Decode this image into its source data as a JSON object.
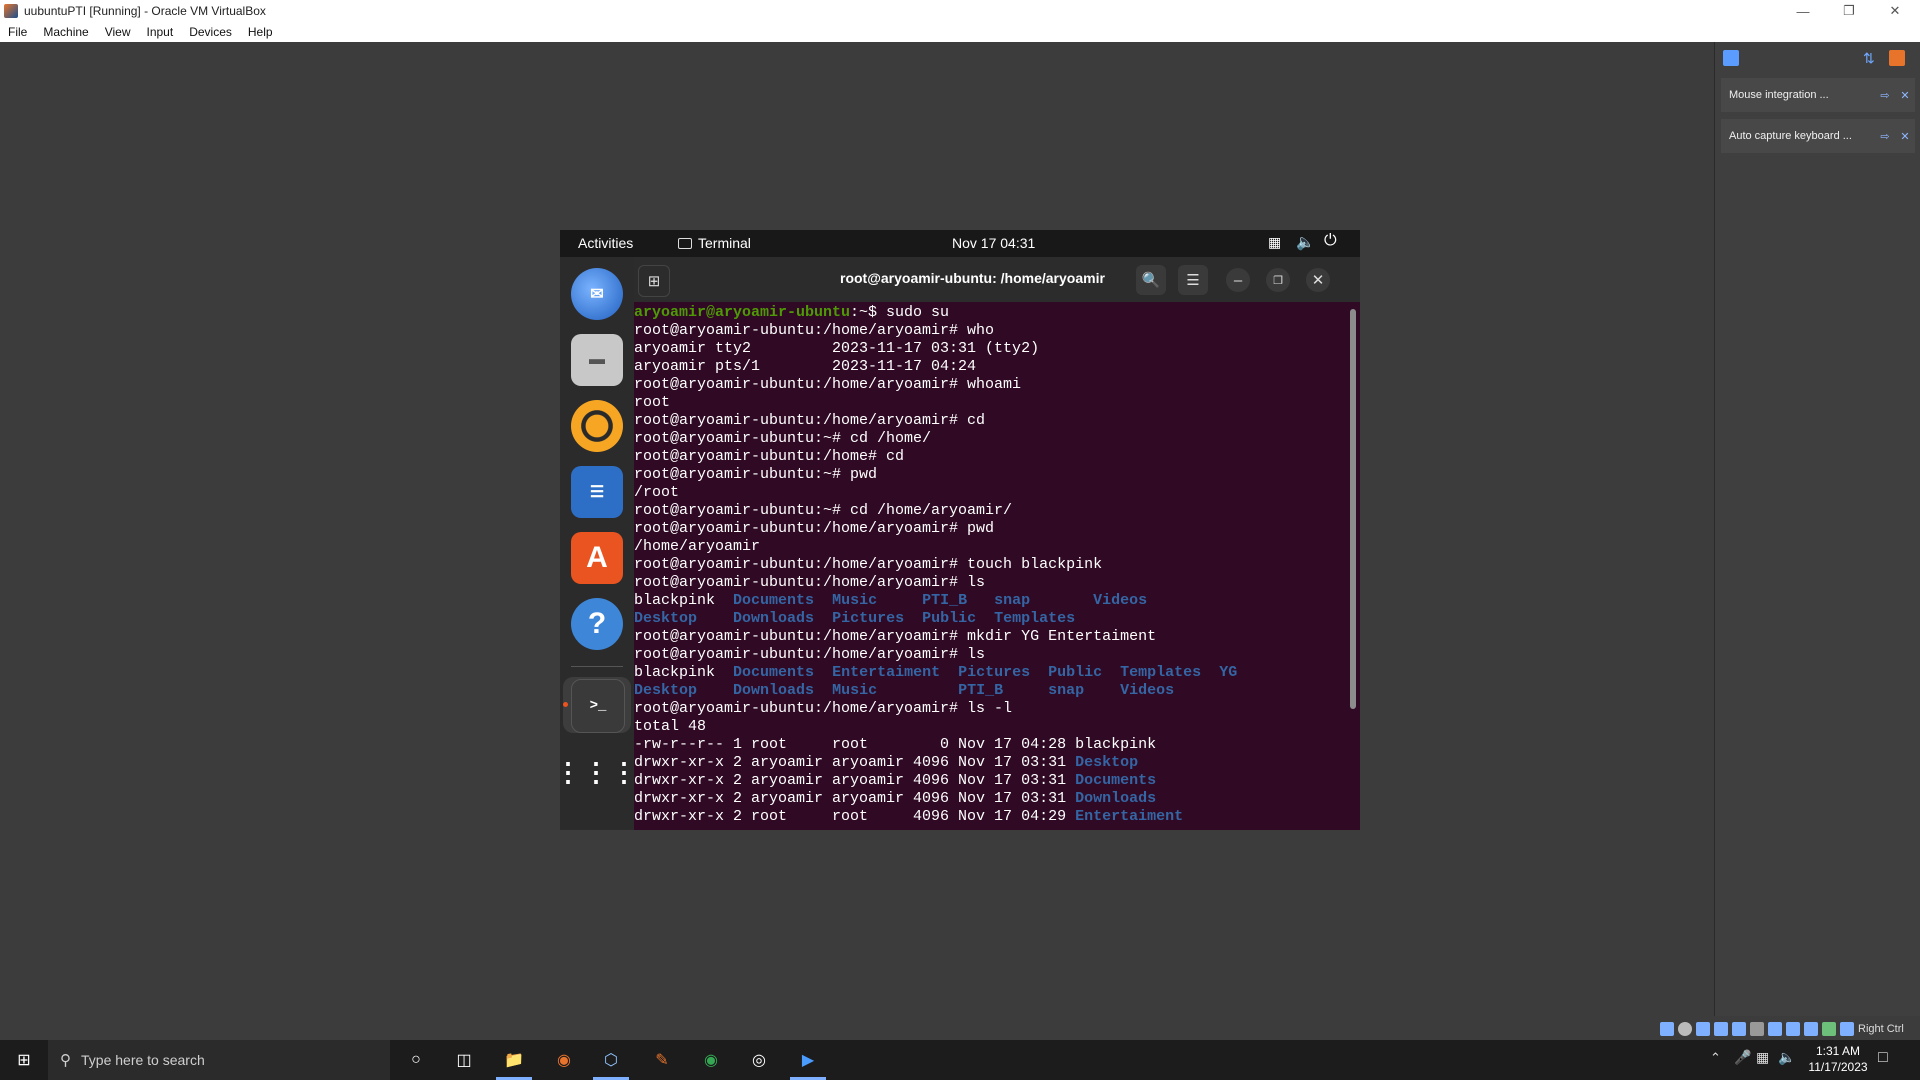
{
  "host": {
    "window_title": "uubuntuPTI [Running] - Oracle VM VirtualBox",
    "menu": [
      "File",
      "Machine",
      "View",
      "Input",
      "Devices",
      "Help"
    ],
    "notifications": [
      {
        "text": "Mouse integration ..."
      },
      {
        "text": "Auto capture keyboard ..."
      }
    ],
    "host_key_label": "Right Ctrl"
  },
  "guest": {
    "topbar": {
      "activities": "Activities",
      "app": "Terminal",
      "clock": "Nov 17  04:31"
    },
    "terminal": {
      "title": "root@aryoamir-ubuntu: /home/aryoamir",
      "lines": [
        [
          {
            "t": "aryoamir@aryoamir-ubuntu",
            "c": "green"
          },
          {
            "t": ":~$ sudo su",
            "c": ""
          }
        ],
        [
          {
            "t": "root@aryoamir-ubuntu:/home/aryoamir# who",
            "c": ""
          }
        ],
        [
          {
            "t": "aryoamir tty2         2023-11-17 03:31 (tty2)",
            "c": ""
          }
        ],
        [
          {
            "t": "aryoamir pts/1        2023-11-17 04:24",
            "c": ""
          }
        ],
        [
          {
            "t": "root@aryoamir-ubuntu:/home/aryoamir# whoami",
            "c": ""
          }
        ],
        [
          {
            "t": "root",
            "c": ""
          }
        ],
        [
          {
            "t": "root@aryoamir-ubuntu:/home/aryoamir# cd",
            "c": ""
          }
        ],
        [
          {
            "t": "root@aryoamir-ubuntu:~# cd /home/",
            "c": ""
          }
        ],
        [
          {
            "t": "root@aryoamir-ubuntu:/home# cd",
            "c": ""
          }
        ],
        [
          {
            "t": "root@aryoamir-ubuntu:~# pwd",
            "c": ""
          }
        ],
        [
          {
            "t": "/root",
            "c": ""
          }
        ],
        [
          {
            "t": "root@aryoamir-ubuntu:~# cd /home/aryoamir/",
            "c": ""
          }
        ],
        [
          {
            "t": "root@aryoamir-ubuntu:/home/aryoamir# pwd",
            "c": ""
          }
        ],
        [
          {
            "t": "/home/aryoamir",
            "c": ""
          }
        ],
        [
          {
            "t": "root@aryoamir-ubuntu:/home/aryoamir# touch blackpink",
            "c": ""
          }
        ],
        [
          {
            "t": "root@aryoamir-ubuntu:/home/aryoamir# ls",
            "c": ""
          }
        ],
        [
          {
            "t": "blackpink  ",
            "c": ""
          },
          {
            "t": "Documents",
            "c": "blue"
          },
          {
            "t": "  ",
            "c": ""
          },
          {
            "t": "Music",
            "c": "blue"
          },
          {
            "t": "     ",
            "c": ""
          },
          {
            "t": "PTI_B",
            "c": "blue"
          },
          {
            "t": "   ",
            "c": ""
          },
          {
            "t": "snap",
            "c": "blue"
          },
          {
            "t": "       ",
            "c": ""
          },
          {
            "t": "Videos",
            "c": "blue"
          }
        ],
        [
          {
            "t": "Desktop",
            "c": "blue"
          },
          {
            "t": "    ",
            "c": ""
          },
          {
            "t": "Downloads",
            "c": "blue"
          },
          {
            "t": "  ",
            "c": ""
          },
          {
            "t": "Pictures",
            "c": "blue"
          },
          {
            "t": "  ",
            "c": ""
          },
          {
            "t": "Public",
            "c": "blue"
          },
          {
            "t": "  ",
            "c": ""
          },
          {
            "t": "Templates",
            "c": "blue"
          }
        ],
        [
          {
            "t": "root@aryoamir-ubuntu:/home/aryoamir# mkdir YG Entertaiment",
            "c": ""
          }
        ],
        [
          {
            "t": "root@aryoamir-ubuntu:/home/aryoamir# ls",
            "c": ""
          }
        ],
        [
          {
            "t": "blackpink  ",
            "c": ""
          },
          {
            "t": "Documents",
            "c": "blue"
          },
          {
            "t": "  ",
            "c": ""
          },
          {
            "t": "Entertaiment",
            "c": "blue"
          },
          {
            "t": "  ",
            "c": ""
          },
          {
            "t": "Pictures",
            "c": "blue"
          },
          {
            "t": "  ",
            "c": ""
          },
          {
            "t": "Public",
            "c": "blue"
          },
          {
            "t": "  ",
            "c": ""
          },
          {
            "t": "Templates",
            "c": "blue"
          },
          {
            "t": "  ",
            "c": ""
          },
          {
            "t": "YG",
            "c": "blue"
          }
        ],
        [
          {
            "t": "Desktop",
            "c": "blue"
          },
          {
            "t": "    ",
            "c": ""
          },
          {
            "t": "Downloads",
            "c": "blue"
          },
          {
            "t": "  ",
            "c": ""
          },
          {
            "t": "Music",
            "c": "blue"
          },
          {
            "t": "         ",
            "c": ""
          },
          {
            "t": "PTI_B",
            "c": "blue"
          },
          {
            "t": "     ",
            "c": ""
          },
          {
            "t": "snap",
            "c": "blue"
          },
          {
            "t": "    ",
            "c": ""
          },
          {
            "t": "Videos",
            "c": "blue"
          }
        ],
        [
          {
            "t": "root@aryoamir-ubuntu:/home/aryoamir# ls -l",
            "c": ""
          }
        ],
        [
          {
            "t": "total 48",
            "c": ""
          }
        ],
        [
          {
            "t": "-rw-r--r-- 1 root     root        0 Nov 17 04:28 blackpink",
            "c": ""
          }
        ],
        [
          {
            "t": "drwxr-xr-x 2 aryoamir aryoamir 4096 Nov 17 03:31 ",
            "c": ""
          },
          {
            "t": "Desktop",
            "c": "blue"
          }
        ],
        [
          {
            "t": "drwxr-xr-x 2 aryoamir aryoamir 4096 Nov 17 03:31 ",
            "c": ""
          },
          {
            "t": "Documents",
            "c": "blue"
          }
        ],
        [
          {
            "t": "drwxr-xr-x 2 aryoamir aryoamir 4096 Nov 17 03:31 ",
            "c": ""
          },
          {
            "t": "Downloads",
            "c": "blue"
          }
        ],
        [
          {
            "t": "drwxr-xr-x 2 root     root     4096 Nov 17 04:29 ",
            "c": ""
          },
          {
            "t": "Entertaiment",
            "c": "blue"
          }
        ]
      ]
    }
  },
  "taskbar": {
    "search_placeholder": "Type here to search",
    "time": "1:31 AM",
    "date": "11/17/2023"
  },
  "colors": {
    "terminal_bg": "#300a24",
    "dir_blue": "#3465a4",
    "prompt_green": "#4e9a06"
  }
}
